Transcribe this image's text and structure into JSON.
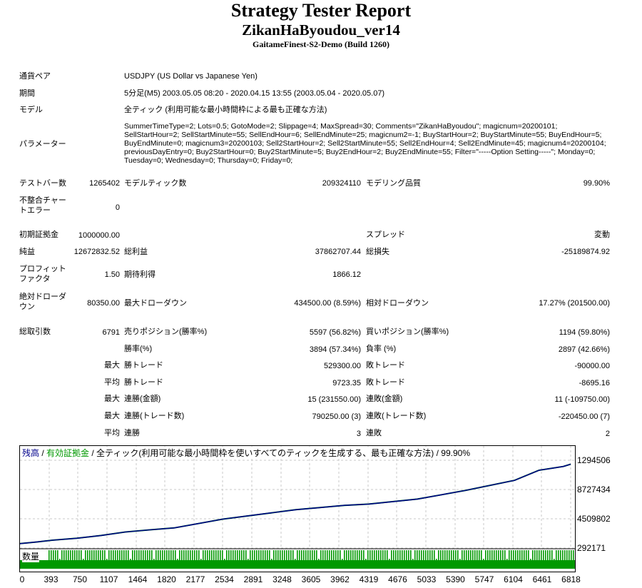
{
  "header": {
    "title": "Strategy Tester Report",
    "subtitle": "ZikanHaByoudou_ver14",
    "build": "GaitameFinest-S2-Demo (Build 1260)"
  },
  "info": {
    "pair_label": "通貨ペア",
    "pair_value": "USDJPY (US Dollar vs Japanese Yen)",
    "period_label": "期間",
    "period_value": "5分足(M5) 2003.05.05 08:20 - 2020.04.15 13:55 (2003.05.04 - 2020.05.07)",
    "model_label": "モデル",
    "model_value": "全ティック (利用可能な最小時間枠による最も正確な方法)",
    "params_label": "パラメーター",
    "params_value": "SummerTimeType=2; Lots=0.5; GotoMode=2; Slippage=4; MaxSpread=30; Comments=\"ZikanHaByoudou\"; magicnum=20200101; SellStartHour=2; SellStartMinute=55; SellEndHour=6; SellEndMinute=25; magicnum2=-1; BuyStartHour=2; BuyStartMinute=55; BuyEndHour=5; BuyEndMinute=0; magicnum3=20200103; Sell2StartHour=2; Sell2StartMinute=55; Sell2EndHour=4; Sell2EndMinute=45; magicnum4=20200104; previousDayEntry=0; Buy2StartHour=0; Buy2StartMinute=5; Buy2EndHour=2; Buy2EndMinute=55; Filter=\"-----Option Setting-----\"; Monday=0; Tuesday=0; Wednesday=0; Thursday=0; Friday=0;"
  },
  "stats": {
    "bars_label": "テストバー数",
    "bars_value": "1265402",
    "ticks_label": "モデルティック数",
    "ticks_value": "209324110",
    "quality_label": "モデリング品質",
    "quality_value": "99.90%",
    "mismatch_label": "不整合チャートエラー",
    "mismatch_value": "0",
    "deposit_label": "初期証拠金",
    "deposit_value": "1000000.00",
    "spread_label": "スプレッド",
    "spread_value": "変動",
    "net_label": "純益",
    "net_value": "12672832.52",
    "gross_profit_label": "総利益",
    "gross_profit_value": "37862707.44",
    "gross_loss_label": "総損失",
    "gross_loss_value": "-25189874.92",
    "pf_label": "プロフィットファクタ",
    "pf_value": "1.50",
    "expected_label": "期待利得",
    "expected_value": "1866.12",
    "abs_dd_label": "絶対ドローダウン",
    "abs_dd_value": "80350.00",
    "max_dd_label": "最大ドローダウン",
    "max_dd_value": "434500.00 (8.59%)",
    "rel_dd_label": "相対ドローダウン",
    "rel_dd_value": "17.27% (201500.00)",
    "total_trades_label": "総取引数",
    "total_trades_value": "6791",
    "short_label": "売りポジション(勝率%)",
    "short_value": "5597 (56.82%)",
    "long_label": "買いポジション(勝率%)",
    "long_value": "1194 (59.80%)",
    "win_rate_label": "勝率(%)",
    "win_rate_value": "3894 (57.34%)",
    "loss_rate_label": "負率 (%)",
    "loss_rate_value": "2897 (42.66%)",
    "max_word": "最大",
    "avg_word": "平均",
    "largest_win_label": "勝トレード",
    "largest_win_value": "529300.00",
    "largest_loss_label": "敗トレード",
    "largest_loss_value": "-90000.00",
    "avg_win_label": "勝トレード",
    "avg_win_value": "9723.35",
    "avg_loss_label": "敗トレード",
    "avg_loss_value": "-8695.16",
    "max_consec_wins_amt_label": "連勝(金額)",
    "max_consec_wins_amt_value": "15 (231550.00)",
    "max_consec_losses_amt_label": "連敗(金額)",
    "max_consec_losses_amt_value": "11 (-109750.00)",
    "max_consec_wins_trades_label": "連勝(トレード数)",
    "max_consec_wins_trades_value": "790250.00 (3)",
    "max_consec_losses_trades_label": "連敗(トレード数)",
    "max_consec_losses_trades_value": "-220450.00 (7)",
    "avg_consec_wins_label": "連勝",
    "avg_consec_wins_value": "3",
    "avg_consec_losses_label": "連敗",
    "avg_consec_losses_value": "2"
  },
  "chart_data": {
    "type": "line",
    "legend": {
      "balance": "残高",
      "sep1": " / ",
      "equity": "有効証拠金",
      "rest": " / 全ティック(利用可能な最小時間枠を使いすべてのティックを生成する、最も正確な方法) / 99.90%"
    },
    "volume_label": "数量",
    "y_ticks": [
      "1294506",
      "8727434",
      "4509802",
      "292171"
    ],
    "x_ticks": [
      "0",
      "393",
      "750",
      "1107",
      "1464",
      "1820",
      "2177",
      "2534",
      "2891",
      "3248",
      "3605",
      "3962",
      "4319",
      "4676",
      "5033",
      "5390",
      "5747",
      "6104",
      "6461",
      "6818"
    ],
    "xlim": [
      0,
      6791
    ],
    "series": [
      {
        "x": [
          0,
          200,
          400,
          700,
          1000,
          1300,
          1600,
          1900,
          2200,
          2500,
          2800,
          3100,
          3400,
          3700,
          4000,
          4300,
          4600,
          4900,
          5200,
          5500,
          5800,
          6100,
          6400,
          6700,
          6791
        ],
        "values": [
          1000000,
          1250000,
          1550000,
          1850000,
          2300000,
          2850000,
          3200000,
          3500000,
          4200000,
          4900000,
          5400000,
          5900000,
          6400000,
          6750000,
          7100000,
          7300000,
          7700000,
          8100000,
          8800000,
          9500000,
          10300000,
          11100000,
          12700000,
          13300000,
          13672832
        ]
      }
    ],
    "colors": {
      "balance": "#00008b",
      "equity": "#009900",
      "volume": "#009900",
      "grid": "#c8c8c8"
    }
  }
}
